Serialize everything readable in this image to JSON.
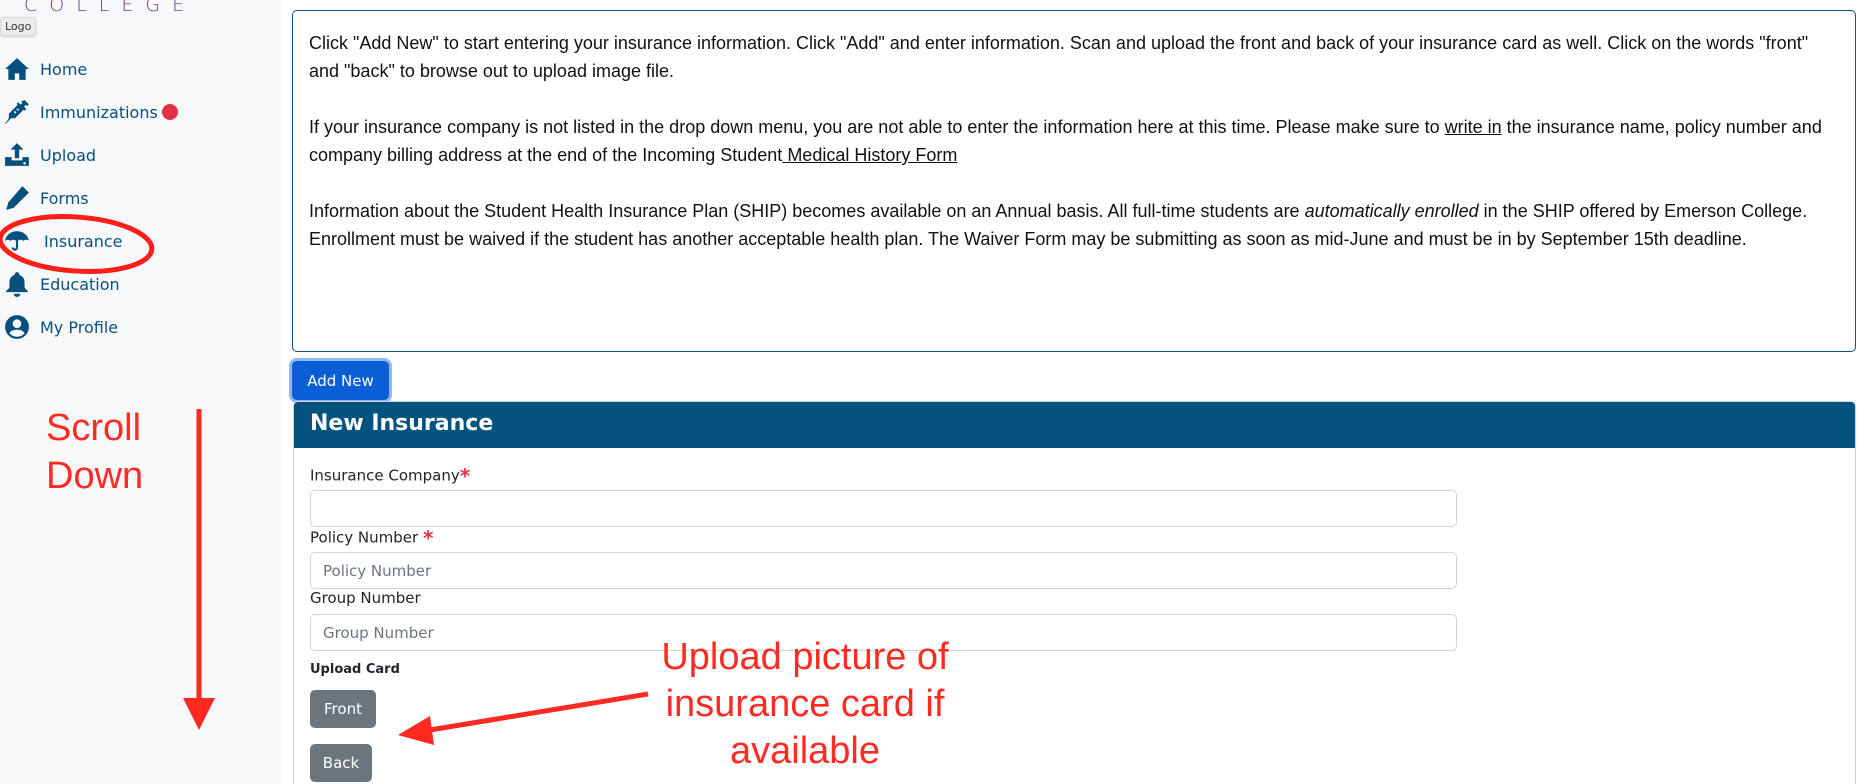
{
  "sidebar": {
    "logo_text": "COLLEGE",
    "logo_tooltip": "Logo",
    "items": [
      {
        "label": "Home",
        "icon": "home-icon"
      },
      {
        "label": "Immunizations",
        "icon": "syringe-icon",
        "badge": true
      },
      {
        "label": "Upload",
        "icon": "upload-icon"
      },
      {
        "label": "Forms",
        "icon": "pencil-icon"
      },
      {
        "label": "Insurance",
        "icon": "umbrella-icon",
        "highlighted": true
      },
      {
        "label": "Education",
        "icon": "bell-icon"
      },
      {
        "label": "My Profile",
        "icon": "user-circle-icon"
      }
    ]
  },
  "info": {
    "p1": "Click \"Add New\" to start entering your insurance information. Click \"Add\" and enter information. Scan and upload the front and back of your insurance card as well. Click on the words \"front\" and \"back\" to browse out to upload image file.",
    "p2_before": "If your insurance company is not listed in the drop down menu, you are not able to enter the information here at this time. Please make sure to ",
    "p2_link1": "write in",
    "p2_middle": " the insurance name, policy number and company billing address at the end of the Incoming Student",
    "p2_link2": " Medical History Form",
    "p3_before": "Information about the Student Health Insurance Plan (SHIP) becomes available on an Annual basis. All full-time students are ",
    "p3_italic": "automatically enrolled",
    "p3_after": " in the SHIP offered by Emerson College. Enrollment must be waived if the student has another acceptable health plan. The Waiver Form may be submitting as soon as mid-June and must be in by September 15th deadline."
  },
  "add_new_label": "Add New",
  "panel": {
    "title": "New Insurance",
    "fields": [
      {
        "label": "Insurance Company",
        "required": "*",
        "value": "",
        "placeholder": ""
      },
      {
        "label": "Policy Number ",
        "required": "*",
        "value": "",
        "placeholder": "Policy Number"
      },
      {
        "label": "Group Number",
        "required": "",
        "value": "",
        "placeholder": "Group Number"
      }
    ],
    "upload_label": "Upload Card",
    "front_label": "Front",
    "back_label": "Back"
  },
  "annotations": {
    "scroll_line1": "Scroll",
    "scroll_line2": "Down",
    "upload_line1": "Upload picture of",
    "upload_line2": "insurance card if",
    "upload_line3": "available"
  },
  "colors": {
    "brand": "#03537e",
    "nav": "#07507e",
    "primary_button": "#0a5fd6",
    "secondary_button": "#6c757d",
    "required": "#e03144",
    "annotation": "#ff2a22"
  }
}
